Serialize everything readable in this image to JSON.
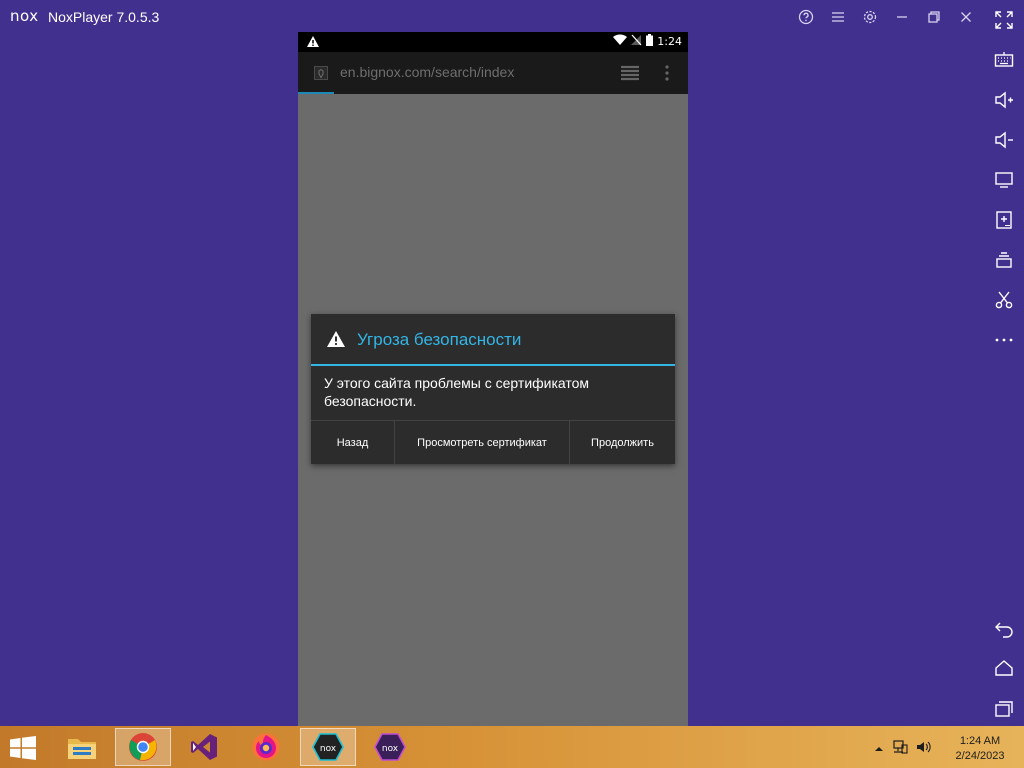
{
  "window": {
    "logo": "nox",
    "title": "NoxPlayer 7.0.5.3",
    "controls": [
      "help-icon",
      "menu-icon",
      "settings-icon",
      "minimize-icon",
      "restore-icon",
      "close-icon"
    ]
  },
  "sidebar": {
    "tools": [
      "fullscreen-icon",
      "keyboard-icon",
      "volume-up-icon",
      "volume-down-icon",
      "screen-icon",
      "add-apk-icon",
      "multi-instance-icon",
      "screenshot-scissors-icon",
      "more-icon",
      "back-icon",
      "home-icon",
      "recent-apps-icon"
    ]
  },
  "android": {
    "status_bar": {
      "time": "1:24"
    },
    "browser": {
      "url": "en.bignox.com/search/index"
    },
    "dialog": {
      "title": "Угроза безопасности",
      "message": "У этого сайта проблемы с сертификатом безопасности.",
      "buttons": {
        "back": "Назад",
        "view_cert": "Просмотреть сертификат",
        "continue": "Продолжить"
      }
    }
  },
  "taskbar": {
    "apps": [
      "file-explorer-icon",
      "chrome-icon",
      "visual-studio-icon",
      "firefox-icon",
      "noxplayer-icon",
      "nox-multi-instance-icon"
    ],
    "clock": {
      "time": "1:24 AM",
      "date": "2/24/2023"
    }
  },
  "colors": {
    "desktop": "#42308e",
    "dialog_accent": "#33b5e5",
    "taskbar": "#d79237"
  }
}
